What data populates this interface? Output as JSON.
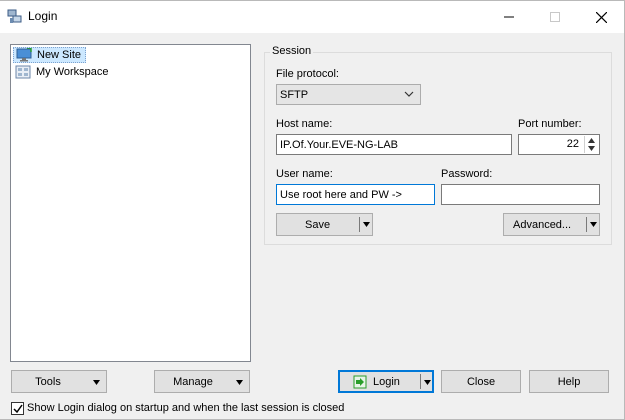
{
  "window": {
    "title": "Login"
  },
  "site_tree": {
    "items": [
      {
        "label": "New Site",
        "icon": "monitor-icon",
        "selected": true
      },
      {
        "label": "My Workspace",
        "icon": "workspace-icon",
        "selected": false
      }
    ]
  },
  "session": {
    "group_title": "Session",
    "file_protocol_label": "File protocol:",
    "file_protocol_value": "SFTP",
    "host_label": "Host name:",
    "host_value": "IP.Of.Your.EVE-NG-LAB",
    "port_label": "Port number:",
    "port_value": "22",
    "user_label": "User name:",
    "user_value": "Use root here and PW ->",
    "password_label": "Password:",
    "password_value": "",
    "save_label": "Save",
    "advanced_label": "Advanced..."
  },
  "footer": {
    "tools_label": "Tools",
    "manage_label": "Manage",
    "login_label": "Login",
    "close_label": "Close",
    "help_label": "Help",
    "show_login_label": "Show Login dialog on startup and when the last session is closed",
    "show_login_checked": true
  },
  "colors": {
    "accent": "#0078d7",
    "selection": "#cce8ff",
    "login_icon": "#2a9d2a"
  }
}
